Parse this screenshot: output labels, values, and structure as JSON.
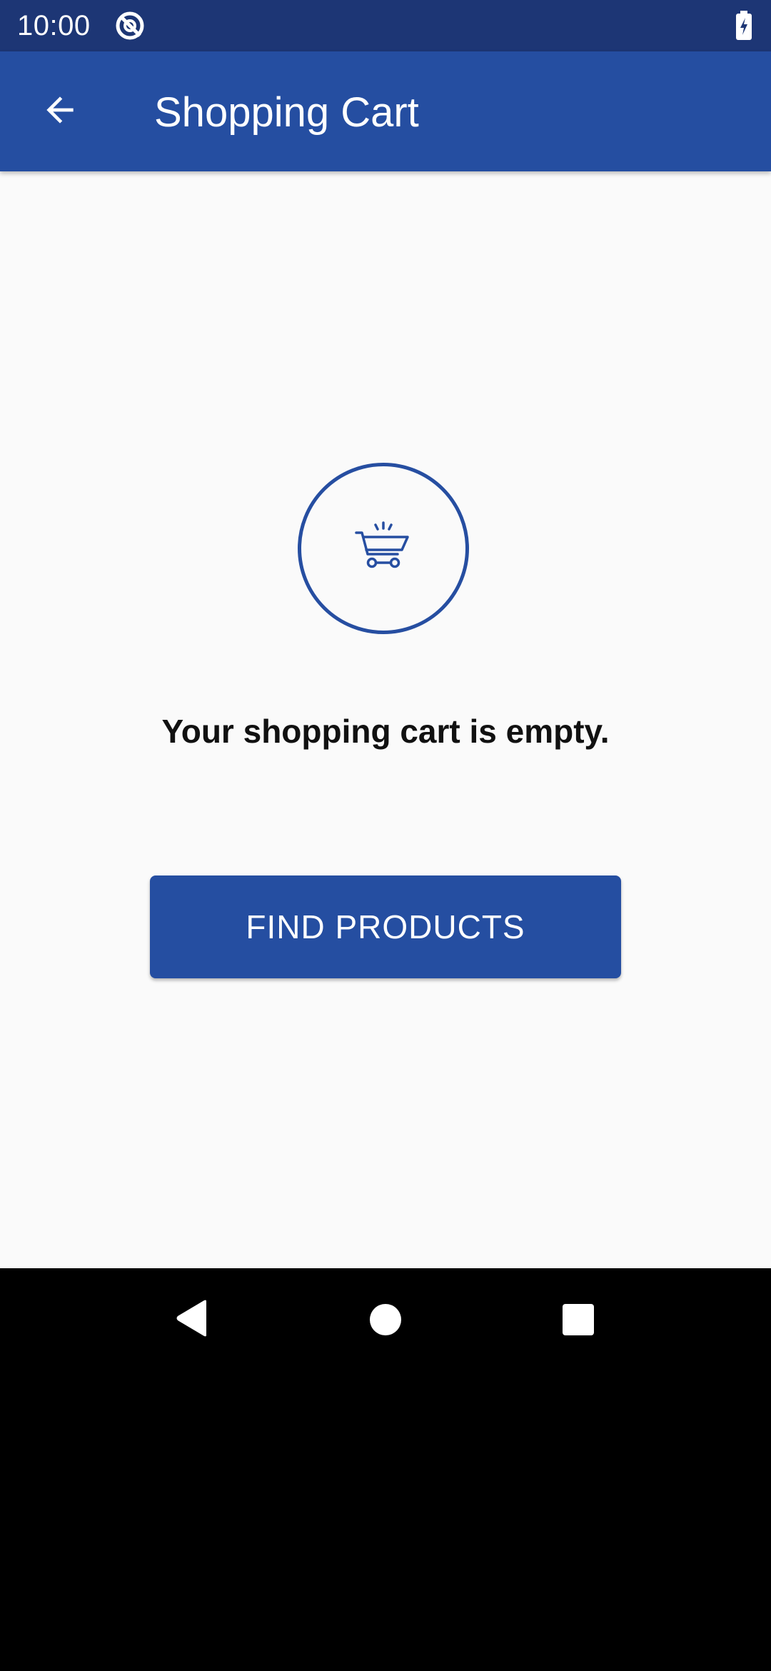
{
  "status_bar": {
    "time": "10:00",
    "icons": [
      "do-not-disturb-icon",
      "battery-charging-icon"
    ]
  },
  "app_bar": {
    "back_icon": "arrow-back-icon",
    "title": "Shopping Cart"
  },
  "empty_state": {
    "icon": "shopping-cart-icon",
    "message": "Your shopping cart is empty.",
    "button_label": "FIND PRODUCTS"
  },
  "nav_bar": {
    "icons": [
      "nav-back-icon",
      "nav-home-icon",
      "nav-recents-icon"
    ]
  },
  "colors": {
    "status_bar": "#1d3675",
    "primary": "#254ea1",
    "background": "#fafafa",
    "nav_bar": "#000000"
  }
}
